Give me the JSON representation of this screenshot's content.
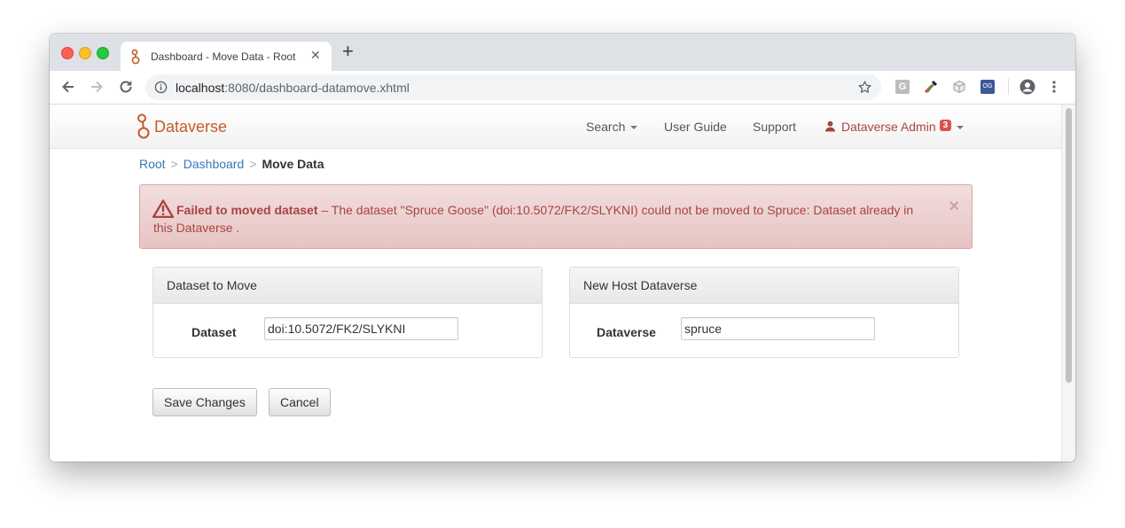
{
  "browser": {
    "tab_title": "Dashboard - Move Data - Root",
    "new_tab_label": "+",
    "tab_close_label": "✕",
    "url_host": "localhost",
    "url_rest": ":8080/dashboard-datamove.xhtml",
    "extension_g_label": "G",
    "extension_og_label": "OG"
  },
  "navbar": {
    "brand": "Dataverse",
    "search": "Search",
    "user_guide": "User Guide",
    "support": "Support",
    "user": "Dataverse Admin",
    "notification_count": "3"
  },
  "breadcrumb": {
    "root": "Root",
    "sep": ">",
    "dashboard": "Dashboard",
    "current": "Move Data"
  },
  "alert": {
    "title": "Failed to moved dataset",
    "message": " – The dataset \"Spruce Goose\" (doi:10.5072/FK2/SLYKNI) could not be moved to Spruce: Dataset already in this Dataverse .",
    "close": "×"
  },
  "dataset_panel": {
    "heading": "Dataset to Move",
    "label": "Dataset",
    "value": "doi:10.5072/FK2/SLYKNI"
  },
  "dataverse_panel": {
    "heading": "New Host Dataverse",
    "label": "Dataverse",
    "value": "spruce"
  },
  "buttons": {
    "save": "Save Changes",
    "cancel": "Cancel"
  },
  "colors": {
    "brand": "#c55b28",
    "link": "#337ab7",
    "alert_text": "#a94442",
    "alert_bg": "#f2dede",
    "badge": "#d9534f"
  }
}
